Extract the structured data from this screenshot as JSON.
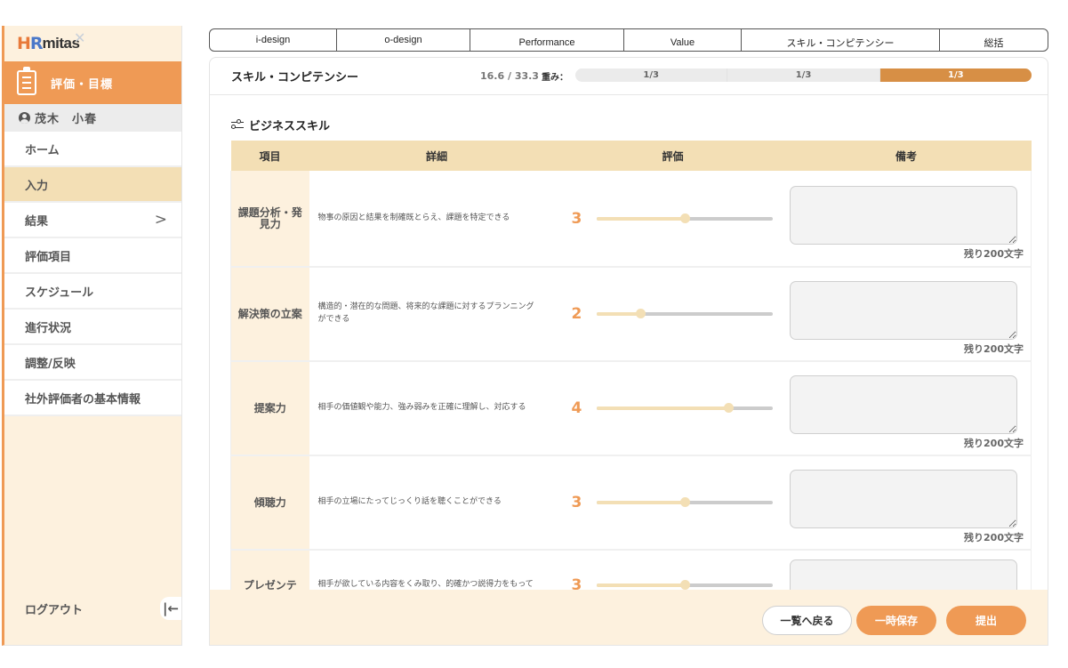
{
  "sidebar": {
    "logo": {
      "h": "H",
      "r": "R",
      "rest": "mitas",
      "x": "✕"
    },
    "header_label": "評価・目標",
    "user_name": "茂木　小春",
    "items": [
      {
        "label": "ホーム",
        "active": false,
        "has_chevron": false
      },
      {
        "label": "入力",
        "active": true,
        "has_chevron": false
      },
      {
        "label": "結果",
        "active": false,
        "has_chevron": true
      },
      {
        "label": "評価項目",
        "active": false,
        "has_chevron": false
      },
      {
        "label": "スケジュール",
        "active": false,
        "has_chevron": false
      },
      {
        "label": "進行状況",
        "active": false,
        "has_chevron": false
      },
      {
        "label": "調整/反映",
        "active": false,
        "has_chevron": false
      },
      {
        "label": "社外評価者の基本情報",
        "active": false,
        "has_chevron": false
      }
    ],
    "chevron_glyph": ">",
    "logout_label": "ログアウト",
    "collapse_glyph": "|←"
  },
  "tabs": [
    {
      "label": "i-design"
    },
    {
      "label": "o-design"
    },
    {
      "label": "Performance"
    },
    {
      "label": "Value"
    },
    {
      "label": "スキル・コンピテンシー"
    },
    {
      "label": "総括"
    }
  ],
  "panel": {
    "title": "スキル・コンピテンシー",
    "score": "16.6 / 33.3",
    "weight_label": "重み：",
    "weight_segments": [
      {
        "label": "1/3",
        "active": false
      },
      {
        "label": "1/3",
        "active": false
      },
      {
        "label": "1/3",
        "active": true
      }
    ],
    "section_title": "ビジネススキル",
    "columns": [
      "項目",
      "詳細",
      "評価",
      "備考"
    ],
    "rating_scale": {
      "min": 1,
      "max": 5
    },
    "rows": [
      {
        "item": "課題分析・発見力",
        "detail": "物事の原因と結果を制確既とらえ、課題を特定できる",
        "rating": 3,
        "note": "",
        "remaining": "残り200文字"
      },
      {
        "item": "解決策の立案",
        "detail": "構造的・潜在的な問題、将来的な課題に対するプランニングができる",
        "rating": 2,
        "note": "",
        "remaining": "残り200文字"
      },
      {
        "item": "提案力",
        "detail": "相手の価値観や能力、強み弱みを正確に理解し、対応する",
        "rating": 4,
        "note": "",
        "remaining": "残り200文字"
      },
      {
        "item": "傾聴力",
        "detail": "相手の立場にたってじっくり話を聴くことができる",
        "rating": 3,
        "note": "",
        "remaining": "残り200文字"
      },
      {
        "item": "プレゼンテ",
        "detail": "相手が欲している内容をくみ取り、的確かつ説得力をもって",
        "rating": 3,
        "note": "",
        "remaining": ""
      }
    ]
  },
  "footer": {
    "back_label": "一覧へ戻る",
    "save_label": "一時保存",
    "submit_label": "提出"
  },
  "colors": {
    "accent": "#ef9a55",
    "accent_dark": "#d78f45",
    "header_bg": "#f3dfb5",
    "sidebar_bg": "#fdf1de"
  }
}
